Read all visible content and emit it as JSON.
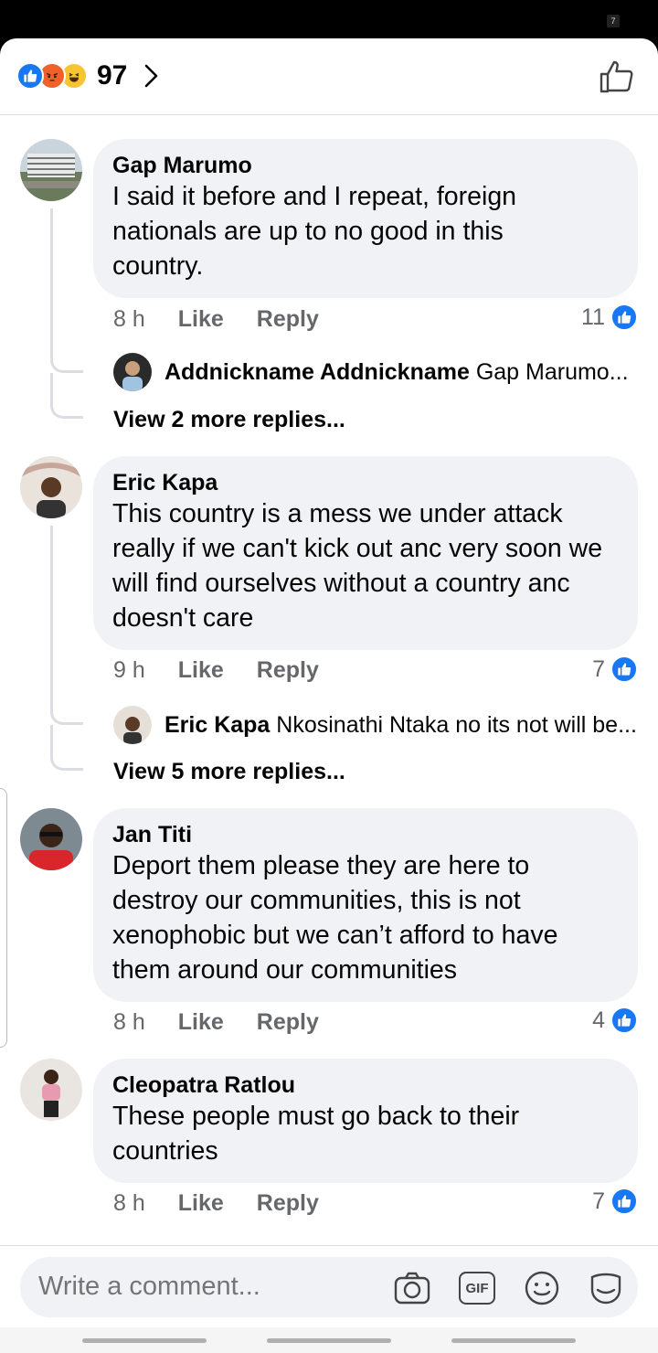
{
  "reactions": {
    "count": "97",
    "types": [
      "like",
      "angry",
      "haha"
    ]
  },
  "comments": [
    {
      "author": "Gap Marumo",
      "text": "I said it before  and I repeat, foreign nationals are up to no good in this country.",
      "time": "8 h",
      "like_label": "Like",
      "reply_label": "Reply",
      "likes": "11",
      "reply_preview": {
        "author": "Addnickname Addnickname",
        "text": "Gap Marumo..."
      },
      "view_more": "View 2 more replies..."
    },
    {
      "author": "Eric Kapa",
      "text": "This country is a mess we under attack really if we can't kick out anc very soon we will find ourselves without a country anc doesn't care",
      "time": "9 h",
      "like_label": "Like",
      "reply_label": "Reply",
      "likes": "7",
      "reply_preview": {
        "author": "Eric Kapa",
        "text": "Nkosinathi Ntaka no its not will be..."
      },
      "view_more": "View 5 more replies..."
    },
    {
      "author": "Jan Titi",
      "text": "Deport them please they are here to destroy our communities, this is not xenophobic but we can’t afford to have them around our communities",
      "time": "8 h",
      "like_label": "Like",
      "reply_label": "Reply",
      "likes": "4"
    },
    {
      "author": "Cleopatra Ratlou",
      "text": "These people must go back to their countries",
      "time": "8 h",
      "like_label": "Like",
      "reply_label": "Reply",
      "likes": "7"
    }
  ],
  "composer": {
    "placeholder": "Write a comment...",
    "gif_label": "GIF"
  },
  "status": {
    "badge": "7"
  },
  "colors": {
    "accent": "#1877f2",
    "bubble": "#f0f2f5",
    "meta": "#65676b"
  }
}
